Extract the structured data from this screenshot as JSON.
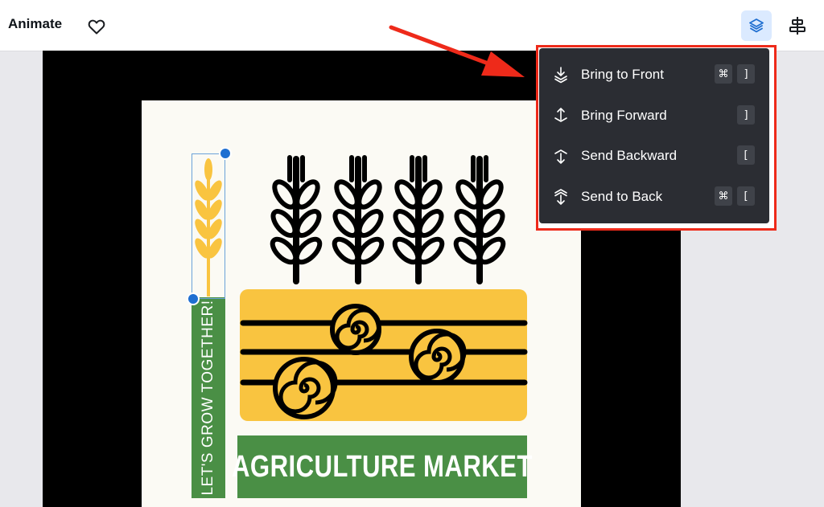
{
  "toolbar": {
    "animate_label": "Animate",
    "icons": {
      "favorite": "heart-icon",
      "position": "layers-icon",
      "align": "align-center-icon"
    }
  },
  "poster": {
    "side_text": "LET'S GROW TOGETHER!",
    "title": "AGRICULTURE MARKET"
  },
  "menu": {
    "items": [
      {
        "label": "Bring to Front",
        "icon": "bring-to-front-icon",
        "keys": [
          "⌘",
          "]"
        ]
      },
      {
        "label": "Bring Forward",
        "icon": "bring-forward-icon",
        "keys": [
          "]"
        ]
      },
      {
        "label": "Send Backward",
        "icon": "send-backward-icon",
        "keys": [
          "["
        ]
      },
      {
        "label": "Send to Back",
        "icon": "send-to-back-icon",
        "keys": [
          "⌘",
          "["
        ]
      }
    ]
  },
  "colors": {
    "accent_blue": "#1f6fd1",
    "annotation_red": "#ee2a1a",
    "menu_bg": "#2b2d33",
    "poster_green": "#4a8f45",
    "poster_yellow": "#f9c440"
  }
}
